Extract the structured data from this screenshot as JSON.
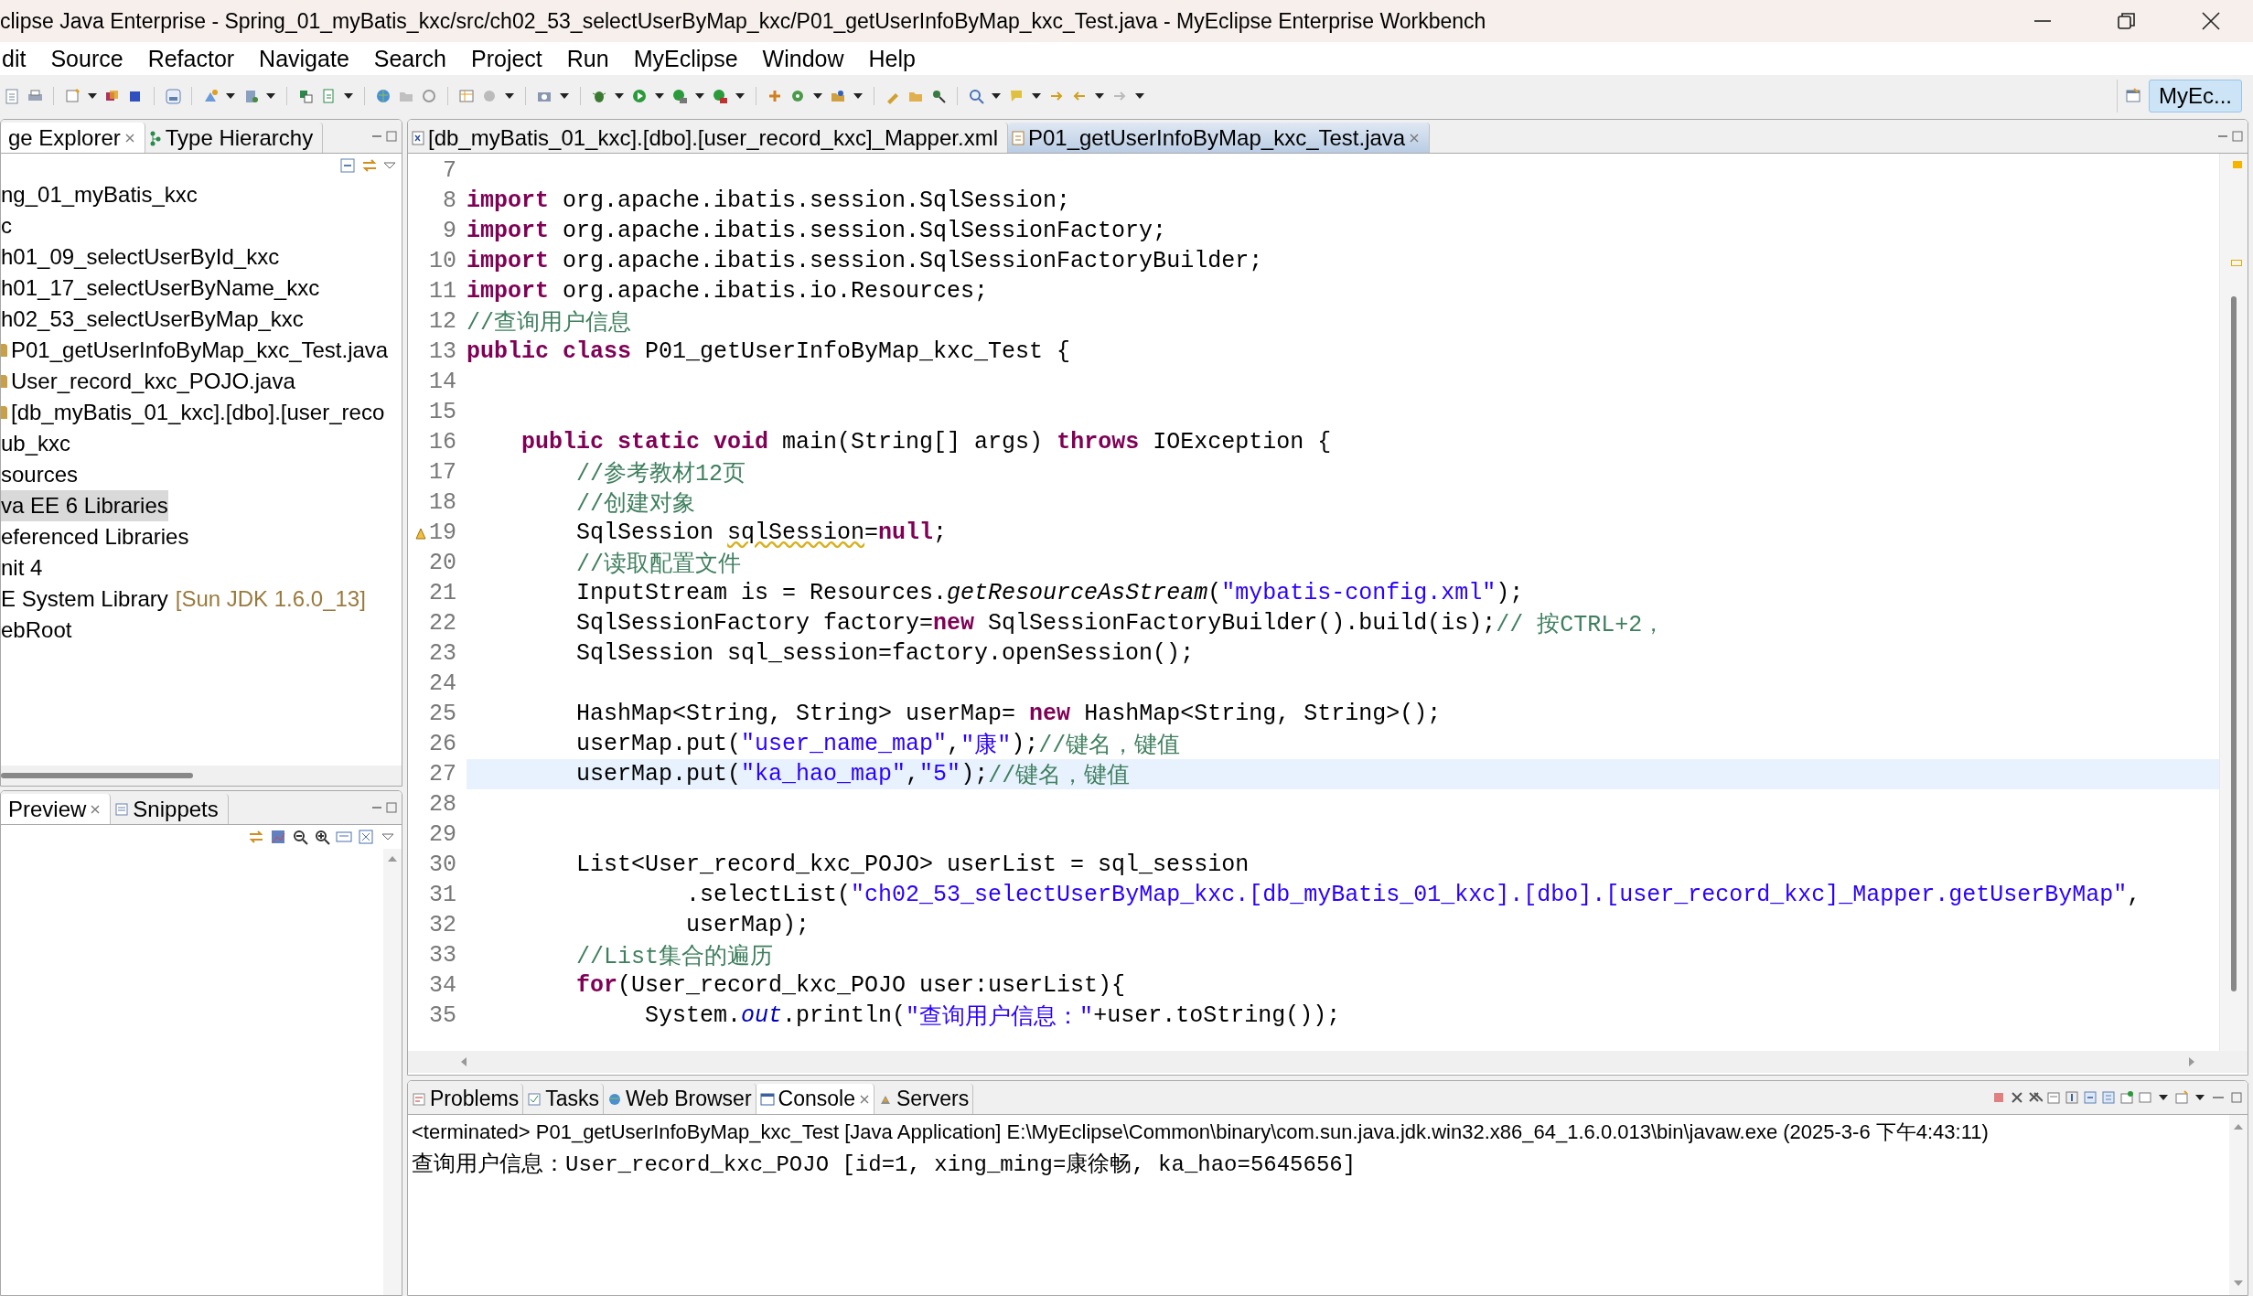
{
  "window": {
    "title": "clipse Java Enterprise - Spring_01_myBatis_kxc/src/ch02_53_selectUserByMap_kxc/P01_getUserInfoByMap_kxc_Test.java - MyEclipse Enterprise Workbench"
  },
  "menu": [
    "dit",
    "Source",
    "Refactor",
    "Navigate",
    "Search",
    "Project",
    "Run",
    "MyEclipse",
    "Window",
    "Help"
  ],
  "perspective": {
    "label": "MyEc...",
    "selected": true
  },
  "explorer": {
    "tabs": [
      {
        "label": "ge Explorer",
        "selected": true,
        "closable": true
      },
      {
        "label": "Type Hierarchy",
        "selected": false,
        "closable": false
      }
    ],
    "tree": [
      {
        "label": "ng_01_myBatis_kxc",
        "selected": false,
        "children": [
          {
            "label": "c",
            "selected": false,
            "children": [
              {
                "label": "h01_09_selectUserById_kxc",
                "selected": false
              },
              {
                "label": "h01_17_selectUserByName_kxc",
                "selected": false
              },
              {
                "label": "h02_53_selectUserByMap_kxc",
                "selected": false,
                "children": [
                  {
                    "label": "P01_getUserInfoByMap_kxc_Test.java",
                    "kind": "file",
                    "selected": false
                  },
                  {
                    "label": "User_record_kxc_POJO.java",
                    "kind": "file",
                    "selected": false
                  },
                  {
                    "label": "[db_myBatis_01_kxc].[dbo].[user_reco",
                    "kind": "file",
                    "selected": false
                  }
                ]
              },
              {
                "label": "ub_kxc",
                "selected": false
              }
            ]
          },
          {
            "label": "sources",
            "selected": false
          },
          {
            "label": "va EE 6 Libraries",
            "selected": true
          },
          {
            "label": "eferenced Libraries",
            "selected": false
          },
          {
            "label": "nit 4",
            "selected": false
          },
          {
            "label": "E System Library",
            "decoration": "[Sun JDK 1.6.0_13]",
            "selected": false
          },
          {
            "label": "ebRoot",
            "selected": false
          }
        ]
      }
    ]
  },
  "preview": {
    "tabs": [
      {
        "label": "Preview",
        "selected": true,
        "closable": true
      },
      {
        "label": "Snippets",
        "selected": false,
        "closable": false
      }
    ]
  },
  "editor": {
    "tabs": [
      {
        "label": "[db_myBatis_01_kxc].[dbo].[user_record_kxc]_Mapper.xml",
        "kind": "xml",
        "selected": false,
        "closable": false
      },
      {
        "label": "P01_getUserInfoByMap_kxc_Test.java",
        "kind": "java",
        "selected": true,
        "closable": true
      }
    ],
    "lines": [
      {
        "number": "7",
        "current": false
      },
      {
        "number": "8",
        "current": false,
        "tokens": [
          {
            "kind": "keyword",
            "text": "import"
          },
          {
            "kind": "plain",
            "text": " org.apache.ibatis.session.SqlSession;"
          }
        ]
      },
      {
        "number": "9",
        "current": false,
        "tokens": [
          {
            "kind": "keyword",
            "text": "import"
          },
          {
            "kind": "plain",
            "text": " org.apache.ibatis.session.SqlSessionFactory;"
          }
        ]
      },
      {
        "number": "10",
        "current": false,
        "tokens": [
          {
            "kind": "keyword",
            "text": "import"
          },
          {
            "kind": "plain",
            "text": " org.apache.ibatis.session.SqlSessionFactoryBuilder;"
          }
        ]
      },
      {
        "number": "11",
        "current": false,
        "tokens": [
          {
            "kind": "keyword",
            "text": "import"
          },
          {
            "kind": "plain",
            "text": " org.apache.ibatis.io.Resources;"
          }
        ]
      },
      {
        "number": "12",
        "current": false,
        "tokens": [
          {
            "kind": "comment",
            "text": "//查询用户信息"
          }
        ]
      },
      {
        "number": "13",
        "current": false,
        "tokens": [
          {
            "kind": "keyword",
            "text": "public class"
          },
          {
            "kind": "plain",
            "text": " P01_getUserInfoByMap_kxc_Test {"
          }
        ]
      },
      {
        "number": "14",
        "current": false
      },
      {
        "number": "15",
        "current": false
      },
      {
        "number": "16",
        "current": false,
        "tokens": [
          {
            "kind": "keyword",
            "text": "    public static void"
          },
          {
            "kind": "plain",
            "text": " main(String[] args) "
          },
          {
            "kind": "keyword",
            "text": "throws"
          },
          {
            "kind": "plain",
            "text": " IOException {"
          }
        ]
      },
      {
        "number": "17",
        "current": false,
        "tokens": [
          {
            "kind": "comment",
            "text": "        //参考教材12页"
          }
        ]
      },
      {
        "number": "18",
        "current": false,
        "tokens": [
          {
            "kind": "comment",
            "text": "        //创建对象"
          }
        ]
      },
      {
        "number": "19",
        "current": false,
        "tokens": [
          {
            "kind": "plain",
            "text": "        SqlSession "
          },
          {
            "kind": "warning",
            "text": "sqlSession"
          },
          {
            "kind": "plain",
            "text": "="
          },
          {
            "kind": "keyword",
            "text": "null"
          },
          {
            "kind": "plain",
            "text": ";"
          }
        ]
      },
      {
        "number": "20",
        "current": false,
        "tokens": [
          {
            "kind": "comment",
            "text": "        //读取配置文件"
          }
        ]
      },
      {
        "number": "21",
        "current": false,
        "tokens": [
          {
            "kind": "plain",
            "text": "        InputStream is = Resources."
          },
          {
            "kind": "static",
            "text": "getResourceAsStream"
          },
          {
            "kind": "plain",
            "text": "("
          },
          {
            "kind": "string",
            "text": "\"mybatis-config.xml\""
          },
          {
            "kind": "plain",
            "text": ");"
          }
        ]
      },
      {
        "number": "22",
        "current": false,
        "tokens": [
          {
            "kind": "plain",
            "text": "        SqlSessionFactory factory="
          },
          {
            "kind": "keyword",
            "text": "new"
          },
          {
            "kind": "plain",
            "text": " SqlSessionFactoryBuilder().build(is);"
          },
          {
            "kind": "comment",
            "text": "// 按CTRL+2，"
          }
        ]
      },
      {
        "number": "23",
        "current": false,
        "tokens": [
          {
            "kind": "plain",
            "text": "        SqlSession sql_session=factory.openSession();"
          }
        ]
      },
      {
        "number": "24",
        "current": false
      },
      {
        "number": "25",
        "current": false,
        "tokens": [
          {
            "kind": "plain",
            "text": "        HashMap<String, String> userMap= "
          },
          {
            "kind": "keyword",
            "text": "new"
          },
          {
            "kind": "plain",
            "text": " HashMap<String, String>();"
          }
        ]
      },
      {
        "number": "26",
        "current": false,
        "tokens": [
          {
            "kind": "plain",
            "text": "        userMap.put("
          },
          {
            "kind": "string",
            "text": "\"user_name_map\""
          },
          {
            "kind": "plain",
            "text": ","
          },
          {
            "kind": "string",
            "text": "\"康\""
          },
          {
            "kind": "plain",
            "text": ");"
          },
          {
            "kind": "comment",
            "text": "//键名，键值"
          }
        ]
      },
      {
        "number": "27",
        "current": true,
        "tokens": [
          {
            "kind": "plain",
            "text": "        userMap.put("
          },
          {
            "kind": "string",
            "text": "\"ka_hao_map\""
          },
          {
            "kind": "plain",
            "text": ","
          },
          {
            "kind": "string",
            "text": "\"5\""
          },
          {
            "kind": "plain",
            "text": ");"
          },
          {
            "kind": "comment",
            "text": "//键名，键值"
          }
        ]
      },
      {
        "number": "28",
        "current": false
      },
      {
        "number": "29",
        "current": false
      },
      {
        "number": "30",
        "current": false,
        "tokens": [
          {
            "kind": "plain",
            "text": "        List<User_record_kxc_POJO> userList = sql_session"
          }
        ]
      },
      {
        "number": "31",
        "current": false,
        "tokens": [
          {
            "kind": "plain",
            "text": "                .selectList("
          },
          {
            "kind": "string",
            "text": "\"ch02_53_selectUserByMap_kxc.[db_myBatis_01_kxc].[dbo].[user_record_kxc]_Mapper.getUserByMap\""
          },
          {
            "kind": "plain",
            "text": ","
          }
        ]
      },
      {
        "number": "32",
        "current": false,
        "tokens": [
          {
            "kind": "plain",
            "text": "                userMap);"
          }
        ]
      },
      {
        "number": "33",
        "current": false,
        "tokens": [
          {
            "kind": "comment",
            "text": "        //List集合的遍历"
          }
        ]
      },
      {
        "number": "34",
        "current": false,
        "tokens": [
          {
            "kind": "keyword",
            "text": "        for"
          },
          {
            "kind": "plain",
            "text": "(User_record_kxc_POJO user:userList){"
          }
        ]
      },
      {
        "number": "35",
        "current": false,
        "tokens": [
          {
            "kind": "plain",
            "text": "             System."
          },
          {
            "kind": "field",
            "text": "out"
          },
          {
            "kind": "plain",
            "text": ".println("
          },
          {
            "kind": "string",
            "text": "\"查询用户信息：\""
          },
          {
            "kind": "plain",
            "text": "+user.toString());"
          }
        ]
      }
    ]
  },
  "console": {
    "tabs": [
      {
        "label": "Problems",
        "selected": false,
        "closable": false
      },
      {
        "label": "Tasks",
        "selected": false,
        "closable": false
      },
      {
        "label": "Web Browser",
        "selected": false,
        "closable": false
      },
      {
        "label": "Console",
        "selected": true,
        "closable": true
      },
      {
        "label": "Servers",
        "selected": false,
        "closable": false
      }
    ],
    "header": "<terminated> P01_getUserInfoByMap_kxc_Test [Java Application] E:\\MyEclipse\\Common\\binary\\com.sun.java.jdk.win32.x86_64_1.6.0.013\\bin\\javaw.exe (2025-3-6 下午4:43:11)",
    "output": [
      "查询用户信息：User_record_kxc_POJO [id=1, xing_ming=康徐畅, ka_hao=5645656]"
    ]
  }
}
